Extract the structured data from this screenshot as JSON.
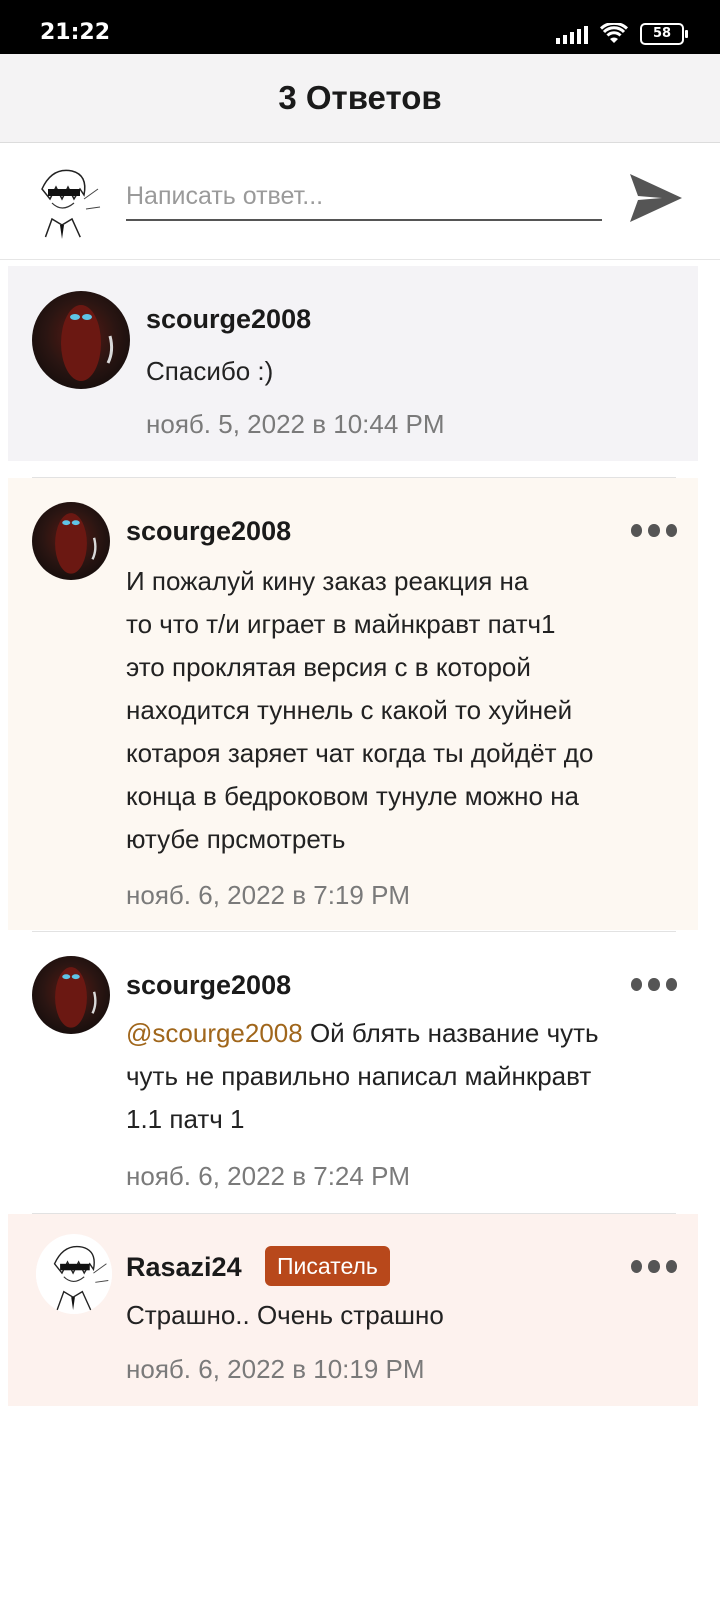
{
  "status_bar": {
    "time": "21:22",
    "battery": "58"
  },
  "header": {
    "title": "3 Ответов"
  },
  "reply": {
    "placeholder": "Написать ответ..."
  },
  "comments": [
    {
      "username": "scourge2008",
      "text": "Спасибо :)",
      "date": "нояб. 5, 2022 в 10:44 PM"
    },
    {
      "username": "scourge2008",
      "lines": [
        "И пожалуй кину заказ реакция на",
        "то что т/и играет в майнкравт патч1",
        "это проклятая версия с в которой",
        "находится туннель с какой то хуйней",
        "котароя заряет чат когда ты дойдёт до",
        "конца в бедроковом тунуле можно на",
        "ютубе прсмотреть"
      ],
      "date": "нояб. 6, 2022 в 7:19 PM"
    },
    {
      "username": "scourge2008",
      "mention": "@scourge2008",
      "line1_rest": " Ой блять название чуть",
      "line2": "чуть не правильно написал майнкравт",
      "line3": "1.1 патч 1",
      "date": "нояб. 6, 2022 в 7:24 PM"
    },
    {
      "username": "Rasazi24",
      "badge": "Писатель",
      "text": "Страшно.. Очень страшно",
      "date": "нояб. 6, 2022 в 10:19 PM"
    }
  ],
  "colors": {
    "accent_mention": "#a0661b",
    "badge_bg": "#b8481b",
    "highlight_gray": "#f4f3f6",
    "highlight_cream": "#fdf8f2",
    "highlight_pink": "#fdf2ee"
  }
}
